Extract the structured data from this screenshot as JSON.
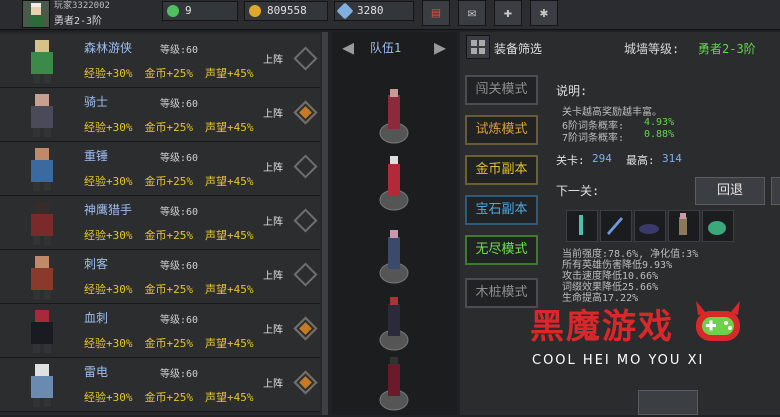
{
  "player": {
    "name": "玩家3322002",
    "rank": "勇者2-3阶"
  },
  "resources": {
    "gems": "9",
    "gold": "809558",
    "diamonds": "3280"
  },
  "top_buttons": [
    {
      "icon": "shop-icon"
    },
    {
      "icon": "mail-icon"
    },
    {
      "icon": "gamepad-icon"
    },
    {
      "icon": "gear-icon"
    }
  ],
  "heroes": [
    {
      "name": "森林游侠",
      "level": "等级:60",
      "exp": "经验+30%",
      "gold": "金币+25%",
      "fame": "声望+45%",
      "deploy": "上阵",
      "deployed": false
    },
    {
      "name": "骑士",
      "level": "等级:60",
      "exp": "经验+30%",
      "gold": "金币+25%",
      "fame": "声望+45%",
      "deploy": "上阵",
      "deployed": true
    },
    {
      "name": "重锤",
      "level": "等级:60",
      "exp": "经验+30%",
      "gold": "金币+25%",
      "fame": "声望+45%",
      "deploy": "上阵",
      "deployed": false
    },
    {
      "name": "神鹰猎手",
      "level": "等级:60",
      "exp": "经验+30%",
      "gold": "金币+25%",
      "fame": "声望+45%",
      "deploy": "上阵",
      "deployed": false
    },
    {
      "name": "刺客",
      "level": "等级:60",
      "exp": "经验+30%",
      "gold": "金币+25%",
      "fame": "声望+45%",
      "deploy": "上阵",
      "deployed": false
    },
    {
      "name": "血刺",
      "level": "等级:60",
      "exp": "经验+30%",
      "gold": "金币+25%",
      "fame": "声望+45%",
      "deploy": "上阵",
      "deployed": true
    },
    {
      "name": "雷电",
      "level": "等级:60",
      "exp": "经验+30%",
      "gold": "金币+25%",
      "fame": "声望+45%",
      "deploy": "上阵",
      "deployed": true
    }
  ],
  "team": {
    "label": "队伍1"
  },
  "right": {
    "equip_filter": "装备筛选",
    "wall_level_label": "城墙等级:",
    "wall_level_value": "勇者2-3阶",
    "modes": [
      "闯关模式",
      "试炼模式",
      "金币副本",
      "宝石副本",
      "无尽模式",
      "木桩模式"
    ],
    "desc_label": "说明:",
    "desc_line": "关卡越高奖励越丰富。",
    "prob6_label": "6阶词条概率:",
    "prob6_value": "4.93%",
    "prob7_label": "7阶词条概率:",
    "prob7_value": "0.88%",
    "stage_label": "关卡:",
    "stage_value": "294",
    "best_label": "最高:",
    "best_value": "314",
    "next_label": "下一关:",
    "back_button": "回退",
    "stats": [
      "当前强度:78.6%, 净化值:3%",
      "所有英雄伤害降低9.93%",
      "攻击速度降低10.66%",
      "词缀效果降低25.66%",
      "生命提高17.22%"
    ]
  },
  "watermark": {
    "title": "黑魔游戏",
    "subtitle": "COOL HEI MO YOU XI"
  }
}
